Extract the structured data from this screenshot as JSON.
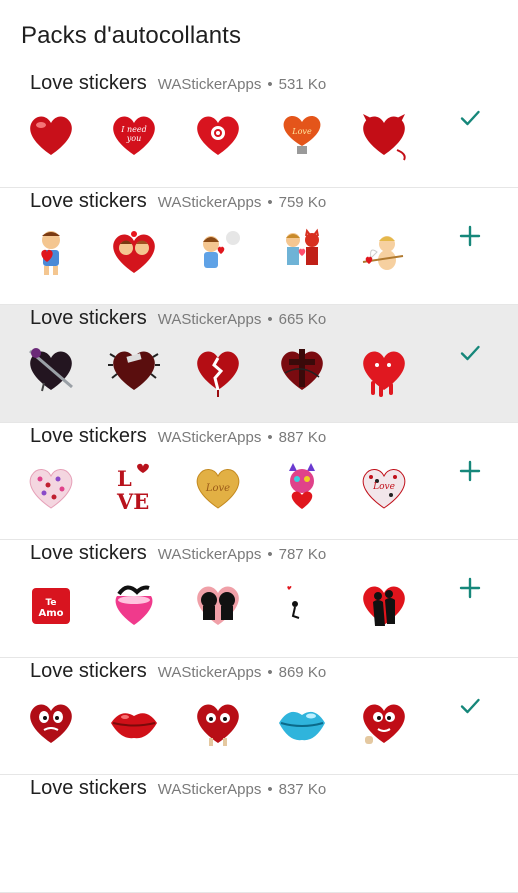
{
  "header": {
    "title": "Packs d'autocollants"
  },
  "packs": [
    {
      "name": "Love stickers",
      "publisher": "WAStickerApps",
      "size": "531 Ko",
      "action": "check-icon",
      "selected": false,
      "stickers": [
        "glossy-heart-sticker",
        "i-need-you-heart-sticker",
        "rose-heart-sticker",
        "love-bulb-sticker",
        "devil-heart-sticker"
      ]
    },
    {
      "name": "Love stickers",
      "publisher": "WAStickerApps",
      "size": "759 Ko",
      "action": "add-icon",
      "selected": false,
      "stickers": [
        "boy-with-heart-sticker",
        "kissing-couple-sticker",
        "girl-blowing-sticker",
        "cartoon-couple-sticker",
        "cupid-sticker"
      ]
    },
    {
      "name": "Love stickers",
      "publisher": "WAStickerApps",
      "size": "665 Ko",
      "action": "check-icon",
      "selected": true,
      "stickers": [
        "pierced-heart-sticker",
        "spiked-heart-sticker",
        "broken-heart-sticker",
        "cross-heart-sticker",
        "melting-heart-sticker"
      ]
    },
    {
      "name": "Love stickers",
      "publisher": "WAStickerApps",
      "size": "887 Ko",
      "action": "add-icon",
      "selected": false,
      "stickers": [
        "pattern-heart-sticker",
        "love-letters-sticker",
        "gold-love-heart-sticker",
        "colorful-cat-heart-sticker",
        "mosaic-love-heart-sticker"
      ]
    },
    {
      "name": "Love stickers",
      "publisher": "WAStickerApps",
      "size": "787 Ko",
      "action": "add-icon",
      "selected": false,
      "stickers": [
        "te-amo-pillow-sticker",
        "silhouette-pink-heart-sticker",
        "kiss-silhouette-heart-sticker",
        "moon-girl-sticker",
        "couple-red-heart-sticker"
      ]
    },
    {
      "name": "Love stickers",
      "publisher": "WAStickerApps",
      "size": "869 Ko",
      "action": "check-icon",
      "selected": false,
      "stickers": [
        "grumpy-heart-sticker",
        "red-lips-sticker",
        "shy-heart-sticker",
        "blue-lips-sticker",
        "waving-heart-sticker"
      ]
    },
    {
      "name": "Love stickers",
      "publisher": "WAStickerApps",
      "size": "837 Ko",
      "action": "",
      "selected": false,
      "stickers": []
    }
  ]
}
